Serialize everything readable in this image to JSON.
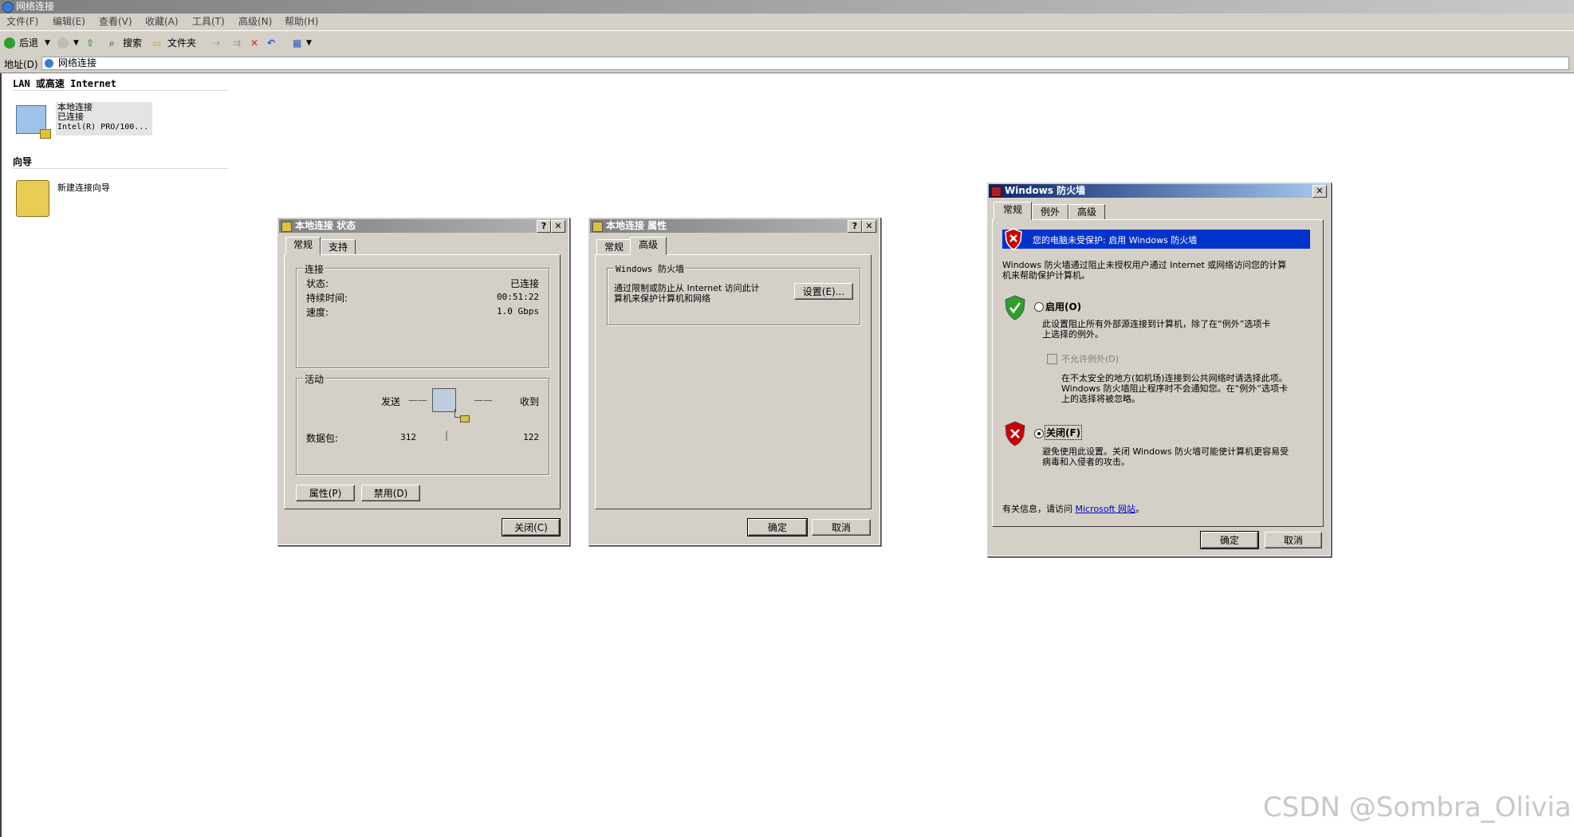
{
  "window": {
    "title": "网络连接"
  },
  "menu": [
    "文件(F)",
    "编辑(E)",
    "查看(V)",
    "收藏(A)",
    "工具(T)",
    "高级(N)",
    "帮助(H)"
  ],
  "toolbar": {
    "back": "后退",
    "search": "搜索",
    "folders": "文件夹"
  },
  "address": {
    "label": "地址(D)",
    "value": "网络连接"
  },
  "groups": {
    "lan_header": "LAN 或高速 Internet",
    "wizard_header": "向导"
  },
  "lan_item": {
    "name": "本地连接",
    "status": "已连接",
    "device": "Intel(R) PRO/100..."
  },
  "wizard_item": {
    "name": "新建连接向导"
  },
  "status_dialog": {
    "title": "本地连接 状态",
    "tabs": [
      "常规",
      "支持"
    ],
    "connection_group": "连接",
    "status_label": "状态:",
    "status_value": "已连接",
    "duration_label": "持续时间:",
    "duration_value": "00:51:22",
    "speed_label": "速度:",
    "speed_value": "1.0 Gbps",
    "activity_group": "活动",
    "sent_label": "发送",
    "received_label": "收到",
    "packets_label": "数据包:",
    "packets_sent": "312",
    "packets_received": "122",
    "properties_button": "属性(P)",
    "disable_button": "禁用(D)",
    "close_button": "关闭(C)"
  },
  "props_dialog": {
    "title": "本地连接 属性",
    "tabs": [
      "常规",
      "高级"
    ],
    "firewall_group": "Windows 防火墙",
    "firewall_text_1": "通过限制或防止从 Internet 访问此计",
    "firewall_text_2": "算机来保护计算机和网络",
    "settings_button": "设置(E)...",
    "ok_button": "确定",
    "cancel_button": "取消"
  },
  "firewall_dialog": {
    "title": "Windows 防火墙",
    "tabs": [
      "常规",
      "例外",
      "高级"
    ],
    "banner": "您的电脑未受保护: 启用 Windows 防火墙",
    "intro_1": "Windows 防火墙通过阻止未授权用户通过 Internet 或网络访问您的计算",
    "intro_2": "机来帮助保护计算机。",
    "on_label": "启用(O)",
    "on_desc_1": "此设置阻止所有外部源连接到计算机，除了在“例外”选项卡",
    "on_desc_2": "上选择的例外。",
    "no_exceptions_label": "不允许例外(D)",
    "no_exc_desc_1": "在不太安全的地方(如机场)连接到公共网络时请选择此项。",
    "no_exc_desc_2": "Windows 防火墙阻止程序时不会通知您。在“例外”选项卡",
    "no_exc_desc_3": "上的选择将被忽略。",
    "off_label": "关闭(F)",
    "off_desc_1": "避免使用此设置。关闭 Windows 防火墙可能使计算机更容易受",
    "off_desc_2": "病毒和入侵者的攻击。",
    "more_info": "有关信息，请访问",
    "more_info_link": "Microsoft 网站",
    "more_info_end": "。",
    "ok_button": "确定",
    "cancel_button": "取消"
  },
  "watermark": "CSDN @Sombra_Olivia",
  "colors": {
    "title_active": "#0a246a",
    "dialog_bg": "#d4d0c8",
    "banner_bg": "#0033cc",
    "shield_red": "#cc0000",
    "shield_green": "#2e9e2e"
  }
}
